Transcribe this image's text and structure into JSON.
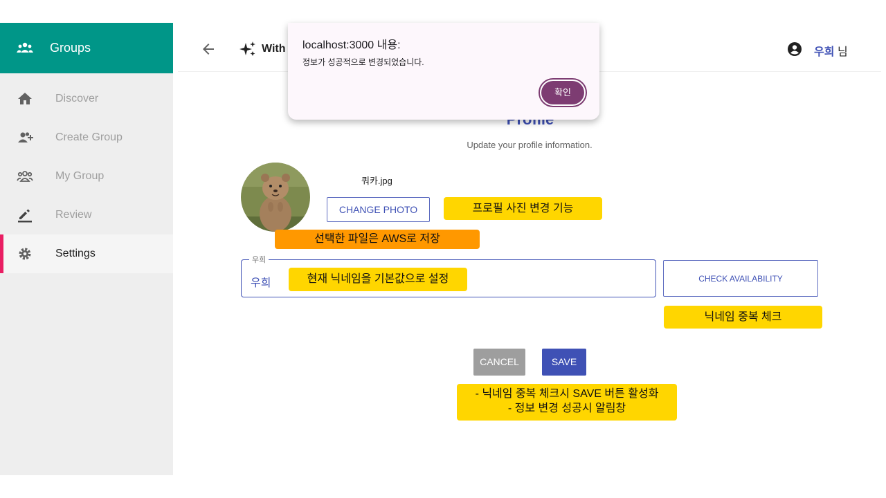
{
  "sidebar": {
    "brand": {
      "label": "Groups",
      "icon": "groups-icon"
    },
    "items": [
      {
        "label": "Discover",
        "icon": "home-icon"
      },
      {
        "label": "Create Group",
        "icon": "group-add-icon"
      },
      {
        "label": "My Group",
        "icon": "people-outline-icon"
      },
      {
        "label": "Review",
        "icon": "edit-icon"
      },
      {
        "label": "Settings",
        "icon": "gear-icon",
        "active": true
      }
    ]
  },
  "header": {
    "logo_text": "With",
    "user_name": "우희",
    "user_suffix": "님"
  },
  "profile": {
    "title": "Profile",
    "subtitle": "Update your profile information.",
    "file_name": "쿼카.jpg",
    "change_photo_label": "CHANGE PHOTO",
    "nickname_legend": "우희",
    "nickname_value": "우희",
    "check_label": "CHECK AVAILABILITY",
    "cancel_label": "CANCEL",
    "save_label": "SAVE"
  },
  "annotations": {
    "photo_change": "프로필 사진 변경 기능",
    "aws_storage": "선택한 파일은 AWS로 저장",
    "default_nickname": "현재 닉네임을 기본값으로 설정",
    "duplicate_check": "닉네임 중복 체크",
    "save_line1": "- 닉네임 중복 체크시 SAVE 버튼 활성화",
    "save_line2": "- 정보 변경 성공시 알림창"
  },
  "dialog": {
    "title": "localhost:3000 내용:",
    "message": "정보가 성공적으로 변경되었습니다.",
    "ok_label": "확인"
  },
  "colors": {
    "brand": "#009688",
    "primary": "#3f51b5",
    "active_bar": "#e91e63",
    "note_yellow": "#ffd600",
    "note_orange": "#ff9800",
    "dialog_button": "#7d3c72"
  }
}
